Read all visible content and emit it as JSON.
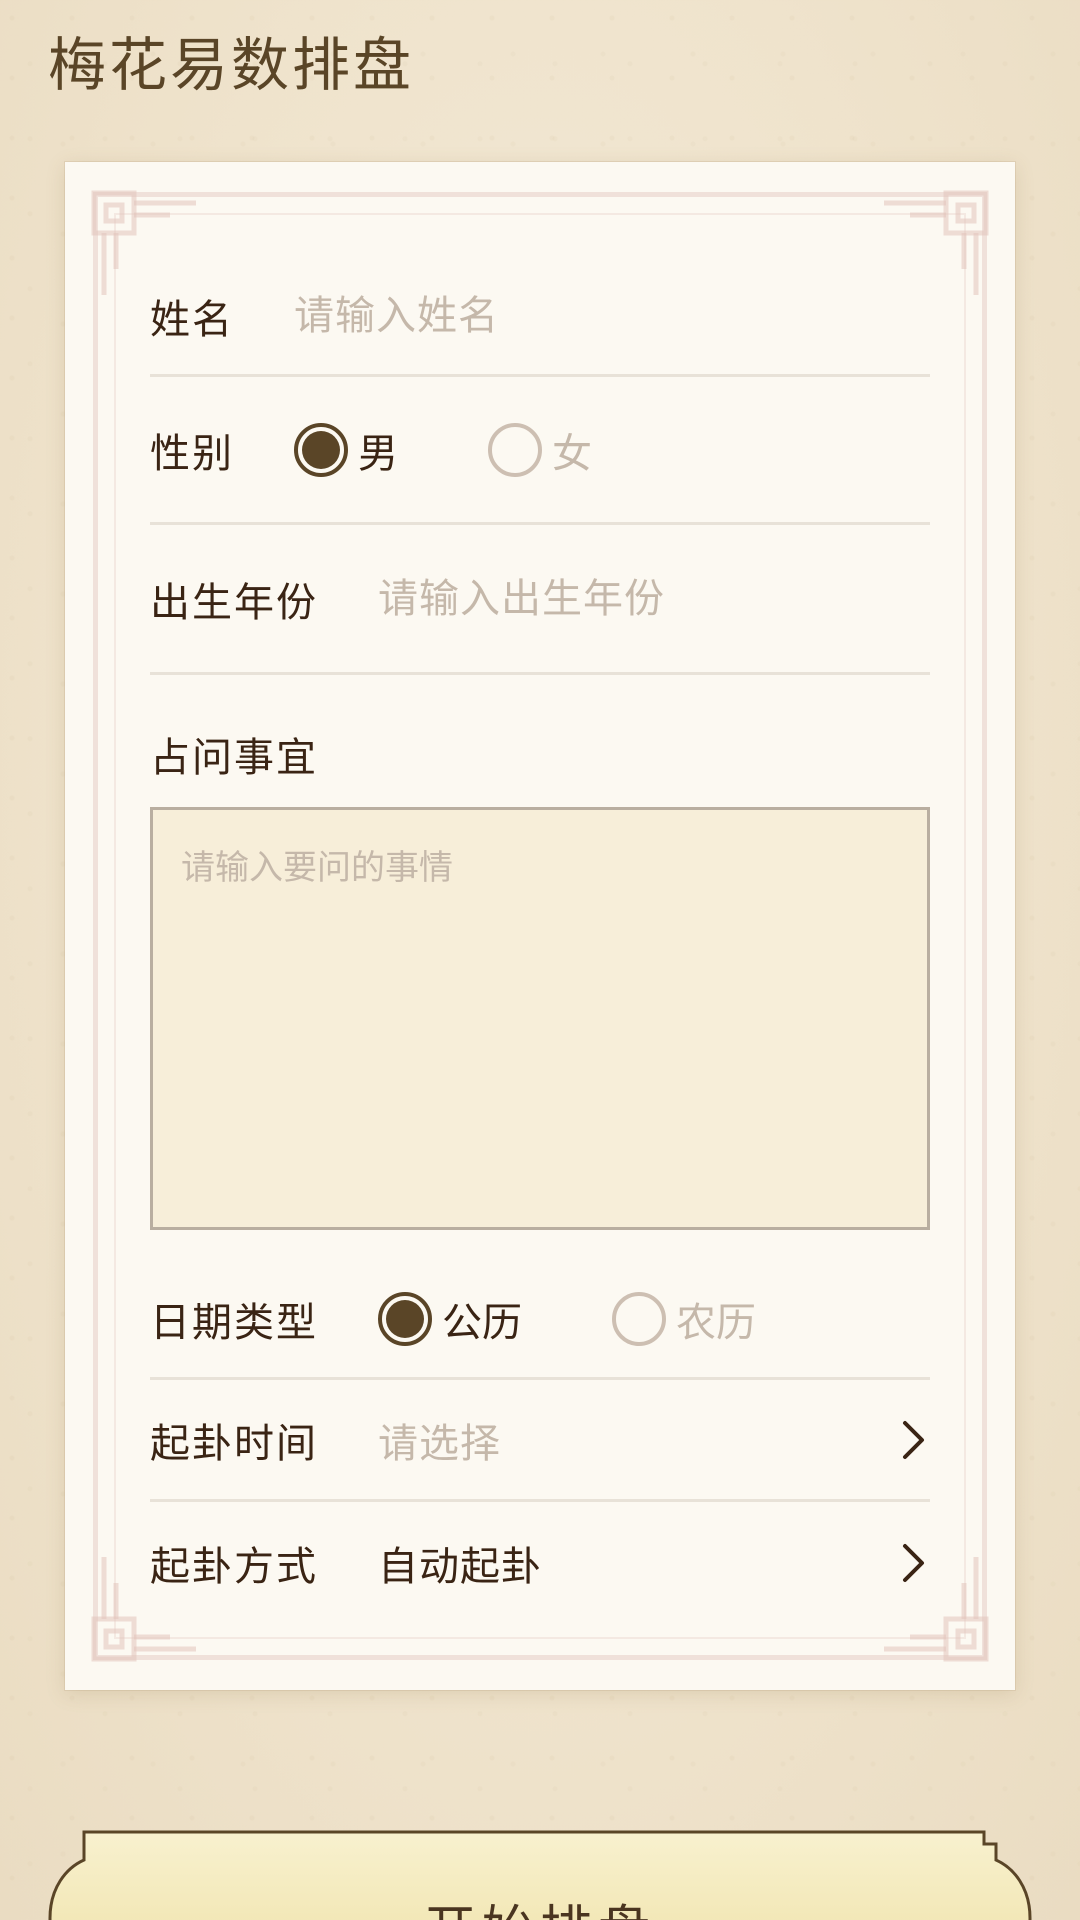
{
  "page": {
    "title": "梅花易数排盘"
  },
  "form": {
    "name": {
      "label": "姓名",
      "placeholder": "请输入姓名"
    },
    "gender": {
      "label": "性别",
      "options": [
        {
          "label": "男",
          "selected": true
        },
        {
          "label": "女",
          "selected": false
        }
      ]
    },
    "birth_year": {
      "label": "出生年份",
      "placeholder": "请输入出生年份"
    },
    "question": {
      "label": "占问事宜",
      "placeholder": "请输入要问的事情"
    },
    "date_type": {
      "label": "日期类型",
      "options": [
        {
          "label": "公历",
          "selected": true
        },
        {
          "label": "农历",
          "selected": false
        }
      ]
    },
    "divination_time": {
      "label": "起卦时间",
      "value": "请选择"
    },
    "divination_method": {
      "label": "起卦方式",
      "value": "自动起卦"
    }
  },
  "actions": {
    "start_label": "开始排盘"
  },
  "colors": {
    "brand": "#5a4527",
    "text": "#3a2414",
    "placeholder": "#c5b8aa",
    "card": "#fcf9f2",
    "textarea_bg": "#f7eed9"
  },
  "icons": {
    "row_chevron": "chevron-right-icon",
    "radio": "radio-button"
  }
}
